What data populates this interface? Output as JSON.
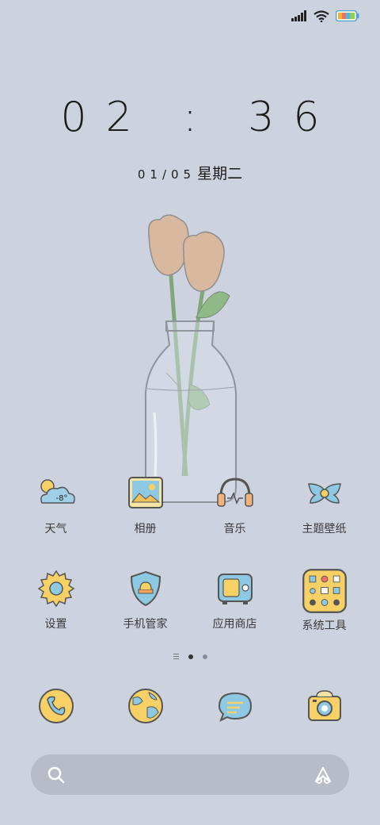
{
  "status": {
    "battery_colors": [
      "#f2b233",
      "#ef6f6c",
      "#54b6e8",
      "#8dd14f"
    ]
  },
  "lockscreen": {
    "time": "02 : 36",
    "date_num": "01/05",
    "weekday": "星期二"
  },
  "weather": {
    "temperature": "-8°"
  },
  "apps": [
    {
      "label": "天气",
      "icon": "weather-icon"
    },
    {
      "label": "相册",
      "icon": "gallery-icon"
    },
    {
      "label": "音乐",
      "icon": "music-icon"
    },
    {
      "label": "主题壁纸",
      "icon": "themes-icon"
    },
    {
      "label": "设置",
      "icon": "settings-icon"
    },
    {
      "label": "手机管家",
      "icon": "security-icon"
    },
    {
      "label": "应用商店",
      "icon": "app-store-icon"
    },
    {
      "label": "系统工具",
      "icon": "system-tools-icon"
    }
  ],
  "dock": [
    {
      "icon": "phone-icon"
    },
    {
      "icon": "browser-icon"
    },
    {
      "icon": "messages-icon"
    },
    {
      "icon": "camera-icon"
    }
  ],
  "pager": {
    "pages": 2,
    "active": 1
  }
}
